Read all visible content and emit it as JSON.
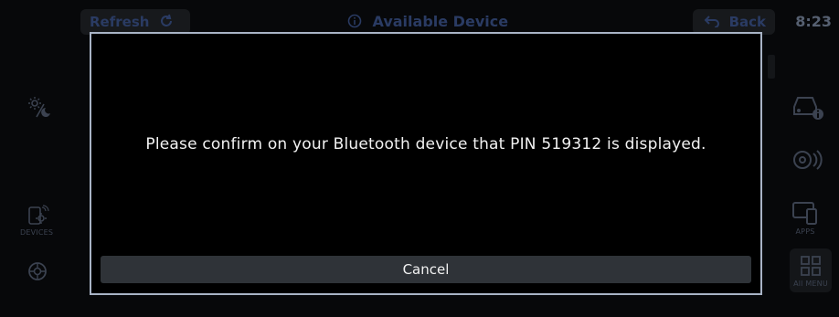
{
  "header": {
    "refresh_label": "Refresh",
    "title": "Available Device",
    "back_label": "Back",
    "clock": "8:23"
  },
  "left_rail": {
    "devices_label": "DEVICES"
  },
  "right_rail": {
    "apps_label": "APPS",
    "allmenu_label": "All MENU"
  },
  "dialog": {
    "message": "Please confirm on your Bluetooth device that PIN 519312 is displayed.",
    "cancel_label": "Cancel"
  },
  "colors": {
    "background": "#07080a",
    "dialog_border": "#a9b4c6",
    "button": "#2f3338",
    "dim_text": "#2a3b63"
  }
}
